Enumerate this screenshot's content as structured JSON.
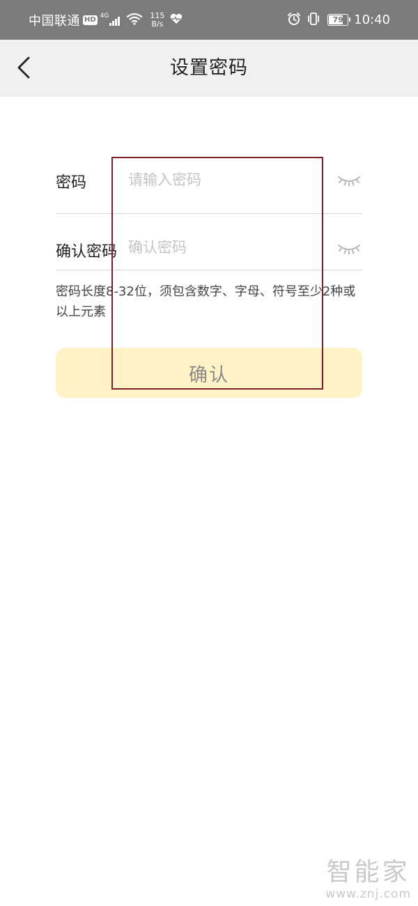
{
  "status_bar": {
    "carrier": "中国联通",
    "hd_badge": "HD",
    "network_type": "4G",
    "speed_value": "115",
    "speed_unit": "B/s",
    "battery_level": "79",
    "battery_fraction": 0.79,
    "time": "10:40"
  },
  "header": {
    "title": "设置密码",
    "back_icon": "chevron-left-icon"
  },
  "form": {
    "password": {
      "label": "密码",
      "placeholder": "请输入密码",
      "value": "",
      "toggle_icon": "eye-closed-icon"
    },
    "confirm_password": {
      "label": "确认密码",
      "placeholder": "确认密码",
      "value": "",
      "toggle_icon": "eye-closed-icon"
    },
    "hint": "密码长度8-32位，须包含数字、字母、符号至少2种或以上元素",
    "submit_label": "确认"
  },
  "colors": {
    "status_bar_bg": "#7b7b7b",
    "header_bg": "#f0f0f0",
    "button_bg": "#fff2c6",
    "button_text": "#8a8a8a",
    "highlight_border": "#7d1f26",
    "placeholder": "#c4c4c4"
  },
  "watermark": {
    "name": "智能家",
    "url": "www.znj.com"
  }
}
